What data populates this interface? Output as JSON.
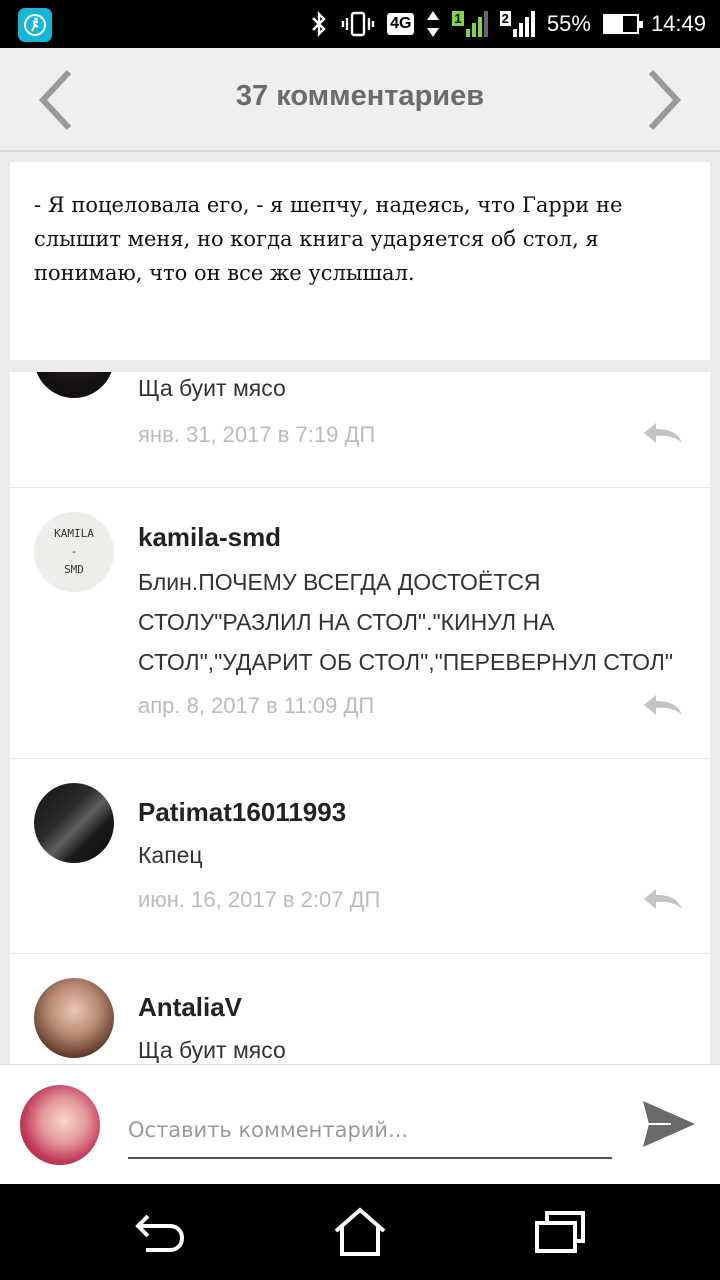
{
  "status_bar": {
    "battery": "55%",
    "battery_level": 0.55,
    "time": "14:49",
    "network": "4G",
    "sim1": "1",
    "sim2": "2"
  },
  "header": {
    "title": "37 комментариев"
  },
  "quote": {
    "text": "- Я поцеловала его, - я шепчу, надеясь, что Гарри не слышит меня, но когда книга ударяется об стол, я понимаю, что он все же услышал."
  },
  "comments": [
    {
      "author": "",
      "text": "Ща буит мясо",
      "time": "янв. 31, 2017 в 7:19 ДП"
    },
    {
      "author": "kamila-smd",
      "avatar_text": [
        "KAMILA",
        "-",
        "SMD"
      ],
      "text": "Блин.ПОЧЕМУ ВСЕГДА ДОСТОЁТСЯ СТОЛУ\"РАЗЛИЛ НА СТОЛ\".\"КИНУЛ НА СТОЛ\",\"УДАРИТ ОБ СТОЛ\",\"ПЕРЕВЕРНУЛ СТОЛ\"",
      "time": "апр. 8, 2017 в 11:09 ДП"
    },
    {
      "author": "Patimat16011993",
      "text": "Капец",
      "time": "июн. 16, 2017 в 2:07 ДП"
    },
    {
      "author": "AntaliaV",
      "text": "Ща буит мясо",
      "time": ""
    }
  ],
  "comment_input": {
    "placeholder": "Оставить комментарий..."
  },
  "colors": {
    "accent_app": "#18b6d6",
    "header_bg": "#efefef",
    "timestamp": "#bbbbbb"
  }
}
